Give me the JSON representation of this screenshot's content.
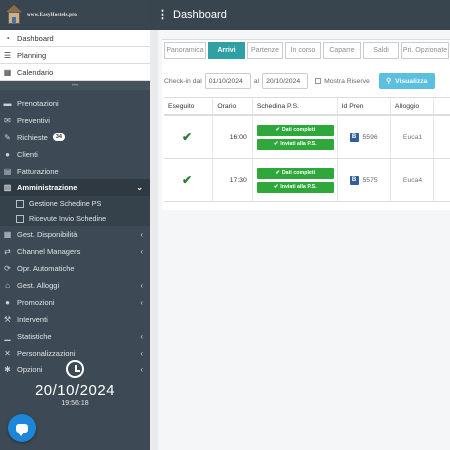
{
  "header": {
    "logo_text": "www.EasyHostels.pro",
    "menu_icon": "vertical-dots-icon",
    "title": "Dashboard"
  },
  "sidebar": {
    "top_links": [
      {
        "label": "Dashboard",
        "icon": "dashboard-icon"
      },
      {
        "label": "Planning",
        "icon": "planning-icon"
      },
      {
        "label": "Calendario",
        "icon": "calendar-icon"
      }
    ],
    "items": [
      {
        "label": "Prenotazioni",
        "icon": "book-icon"
      },
      {
        "label": "Preventivi",
        "icon": "envelope-icon"
      },
      {
        "label": "Richieste",
        "icon": "edit-icon",
        "badge": "34"
      },
      {
        "label": "Clienti",
        "icon": "users-icon"
      },
      {
        "label": "Fatturazione",
        "icon": "invoice-icon"
      },
      {
        "label": "Amministrazione",
        "icon": "building-icon"
      },
      {
        "label": "Gest. Disponibilità",
        "icon": "grid-icon"
      },
      {
        "label": "Channel Managers",
        "icon": "exchange-icon"
      },
      {
        "label": "Opr. Automatiche",
        "icon": "repeat-icon"
      },
      {
        "label": "Gest. Alloggi",
        "icon": "home-icon"
      },
      {
        "label": "Promozioni",
        "icon": "circle-icon"
      },
      {
        "label": "Interventi",
        "icon": "wrench-icon"
      },
      {
        "label": "Statistiche",
        "icon": "chart-icon"
      },
      {
        "label": "Personalizzazioni",
        "icon": "tools-icon"
      },
      {
        "label": "Opzioni",
        "icon": "gear-icon"
      }
    ],
    "sub_items": [
      {
        "label": "Gestione Schedine PS"
      },
      {
        "label": "Ricevute Invio Schedine"
      }
    ],
    "clock_date": "20/10/2024",
    "clock_time": "19:56:18"
  },
  "main": {
    "tabs": [
      {
        "label": "Panoramica"
      },
      {
        "label": "Arrivi"
      },
      {
        "label": "Partenze"
      },
      {
        "label": "In corso"
      },
      {
        "label": "Caparre"
      },
      {
        "label": "Saldi"
      },
      {
        "label": "Pri. Opzionate"
      }
    ],
    "filter": {
      "checkin_label": "Check-in dal",
      "from": "01/10/2024",
      "to_label": "al",
      "to": "20/10/2024",
      "mostra_riserve": "Mostra Riserve",
      "visualizza": "Visualizza"
    },
    "table": {
      "headers": [
        "Eseguito",
        "Orario",
        "Schedina P.S.",
        "Id Pren",
        "Alloggio"
      ],
      "rows": [
        {
          "time": "16:00",
          "label1": "Dati completi",
          "label2": "Inviati alla P.S.",
          "pren_badge": "B",
          "pren_id": "5596",
          "alloggio": "Euca1"
        },
        {
          "time": "17:30",
          "label1": "Dati completi",
          "label2": "Inviati alla P.S.",
          "pren_badge": "B",
          "pren_id": "5575",
          "alloggio": "Euca4"
        }
      ]
    }
  }
}
